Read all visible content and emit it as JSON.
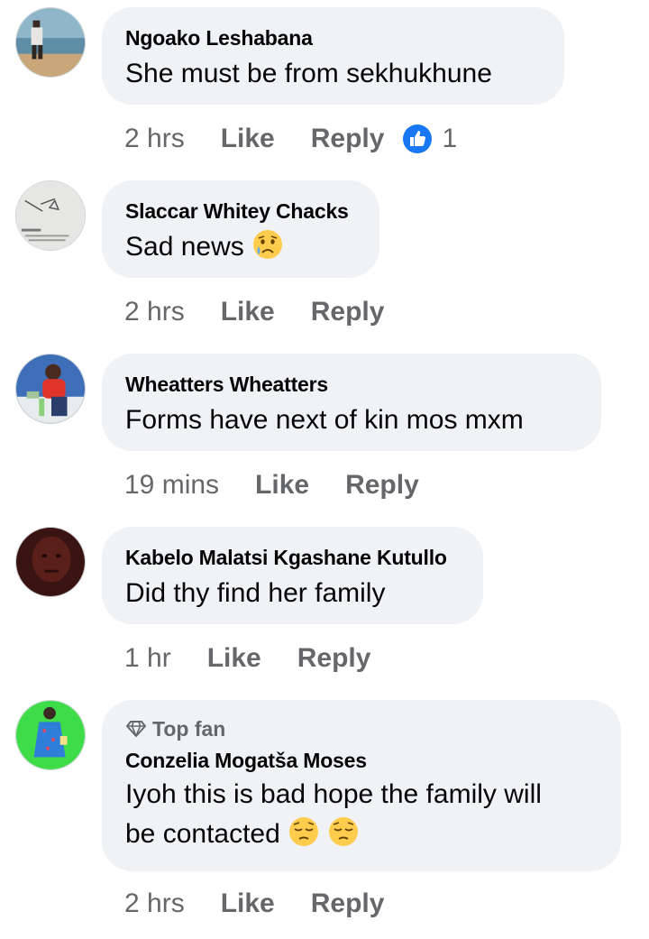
{
  "comments": [
    {
      "author": "Ngoako Leshabana",
      "text": "She must be from sekhukhune",
      "time": "2 hrs",
      "like_label": "Like",
      "reply_label": "Reply",
      "reaction_count": "1",
      "reaction_icon": "like-reaction-icon"
    },
    {
      "author": "Slaccar Whitey Chacks",
      "text": "Sad news",
      "emoji": "crying-face",
      "time": "2 hrs",
      "like_label": "Like",
      "reply_label": "Reply"
    },
    {
      "author": "Wheatters Wheatters",
      "text": "Forms have next of kin mos mxm",
      "time": "19 mins",
      "like_label": "Like",
      "reply_label": "Reply"
    },
    {
      "author": "Kabelo Malatsi Kgashane Kutullo",
      "text": "Did thy find her family",
      "time": "1 hr",
      "like_label": "Like",
      "reply_label": "Reply"
    },
    {
      "badge": "Top fan",
      "badge_icon": "diamond-icon",
      "author": "Conzelia Mogatša Moses",
      "text_line1": "Iyoh this is bad hope the family will",
      "text_line2": "be contacted",
      "emoji": "pensive-face",
      "time": "2 hrs",
      "like_label": "Like",
      "reply_label": "Reply"
    }
  ],
  "colors": {
    "bubble": "#f0f2f5",
    "meta": "#65676b",
    "text": "#050505",
    "like_blue": "#1877f2"
  }
}
